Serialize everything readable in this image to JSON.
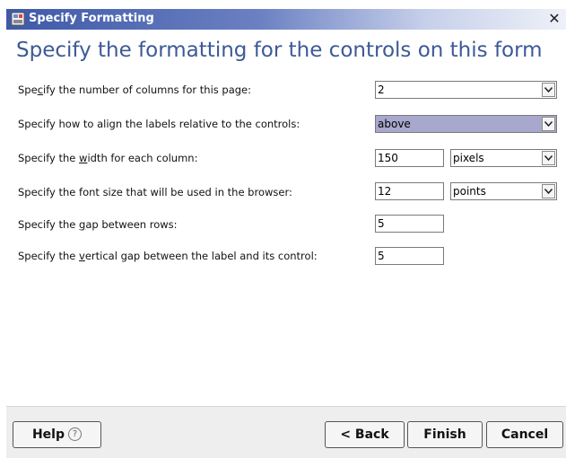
{
  "window": {
    "title": "Specify Formatting",
    "close_glyph": "✕"
  },
  "heading": "Specify the formatting for the controls on this form",
  "fields": [
    {
      "label_pre": "Spe",
      "label_key": "c",
      "label_post": "ify the number of columns for this page:",
      "value": "2"
    },
    {
      "label_pre": "Specify how to align the labels relative to the controls:",
      "label_key": "",
      "label_post": "",
      "value": "above"
    },
    {
      "label_pre": "Specify the ",
      "label_key": "w",
      "label_post": "idth for each column:",
      "value": "150",
      "unit": "pixels"
    },
    {
      "label_pre": "Specify the font size that will be used in the browser:",
      "label_key": "",
      "label_post": "",
      "value": "12",
      "unit": "points"
    },
    {
      "label_pre": "Specify the ",
      "label_key": "g",
      "label_post": "ap between rows:",
      "value": "5"
    },
    {
      "label_pre": "Specify the ",
      "label_key": "v",
      "label_post": "ertical gap between the label and its control:",
      "value": "5"
    }
  ],
  "buttons": {
    "help": "Help",
    "help_icon_glyph": "?",
    "back": "< Back",
    "finish": "Finish",
    "cancel": "Cancel"
  },
  "colors": {
    "heading": "#3c5a96",
    "titlebar_start": "#3f59a8",
    "selected_dropdown": "#a8a8ce"
  }
}
